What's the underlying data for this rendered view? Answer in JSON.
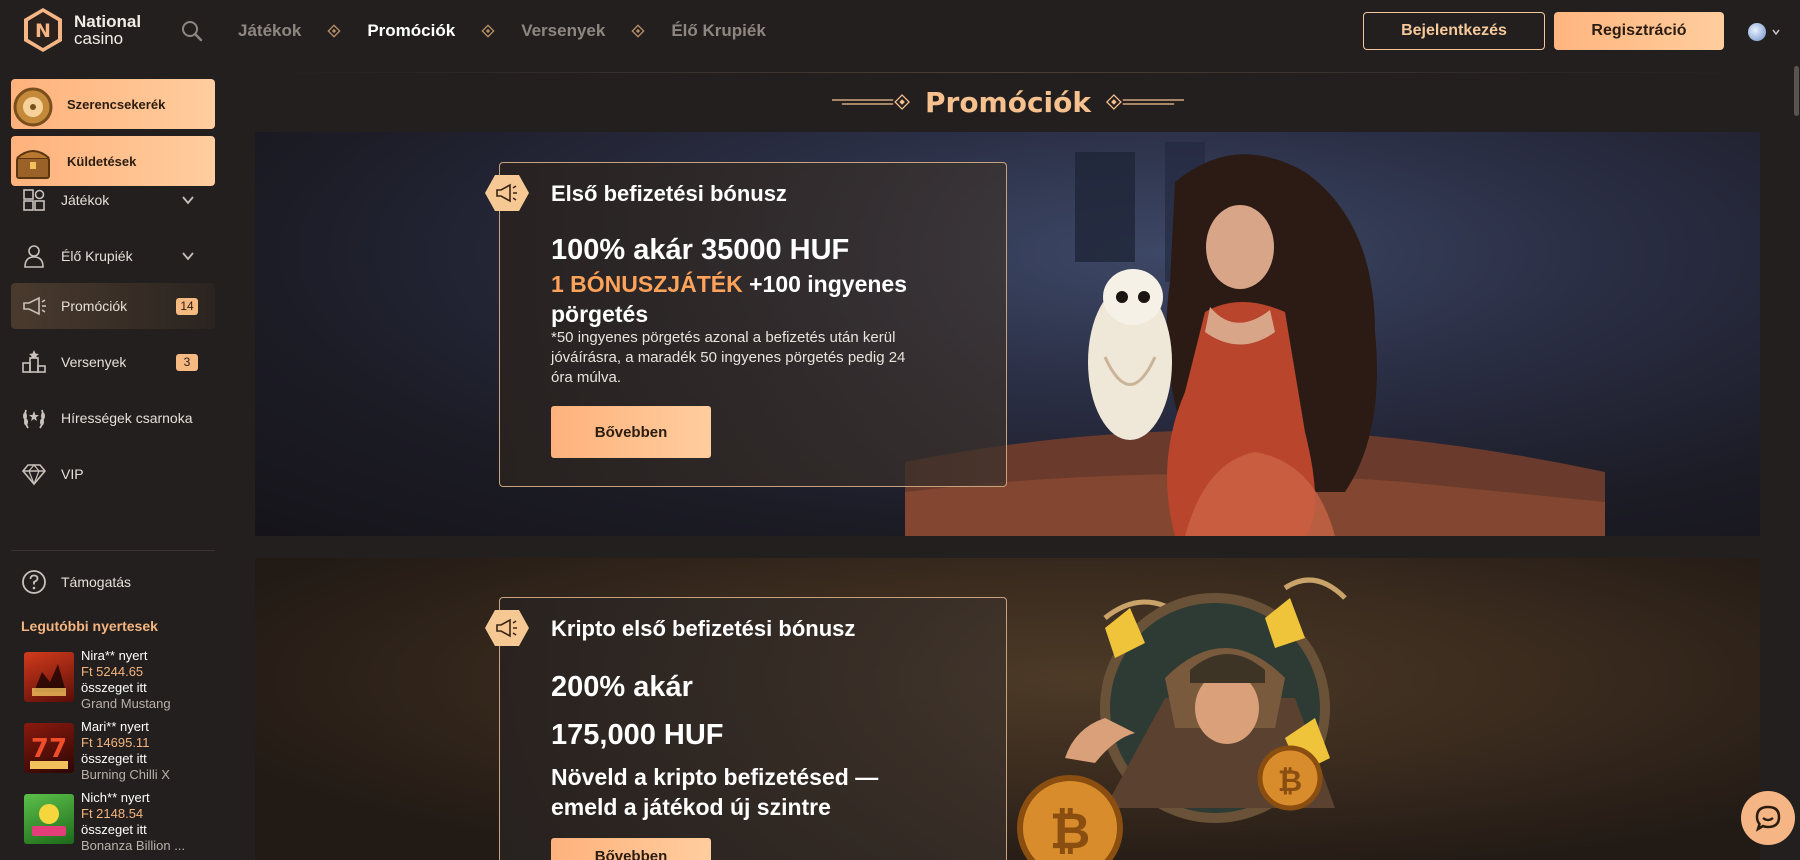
{
  "brand": {
    "line1": "National",
    "line2": "casino",
    "badge_letter": "N"
  },
  "nav": {
    "items": [
      "Játékok",
      "Promóciók",
      "Versenyek",
      "Élő Krupiék"
    ],
    "active": "Promóciók"
  },
  "header": {
    "login_label": "Bejelentkezés",
    "register_label": "Regisztráció"
  },
  "sidebar": {
    "promo_buttons": [
      "Szerencsekerék",
      "Küldetések"
    ],
    "items": [
      {
        "label": "Játékok",
        "icon": "puzzle-icon"
      },
      {
        "label": "Élő Krupiék",
        "icon": "dealer-icon"
      },
      {
        "label": "Promóciók",
        "icon": "megaphone-icon",
        "badge": "14"
      },
      {
        "label": "Versenyek",
        "icon": "tournament-icon",
        "badge": "3"
      },
      {
        "label": "Hírességek csarnoka",
        "icon": "laurel-icon"
      },
      {
        "label": "VIP",
        "icon": "diamond-icon"
      },
      {
        "label": "Támogatás",
        "icon": "help-icon"
      }
    ],
    "wins_title": "Legutóbbi nyertesek",
    "wins": [
      {
        "user": "Nira** nyert",
        "amount": "Ft 5244.65",
        "text": "összeget itt",
        "game": "Grand Mustang"
      },
      {
        "user": "Mari** nyert",
        "amount": "Ft 14695.11",
        "text": "összeget itt",
        "game": "Burning Chilli X"
      },
      {
        "user": "Nich** nyert",
        "amount": "Ft 2148.54",
        "text": "összeget itt",
        "game": "Bonanza Billion ..."
      }
    ]
  },
  "page": {
    "title": "Promóciók"
  },
  "promos": [
    {
      "title": "Első befizetési bónusz",
      "headline": "100% akár 35000 HUF",
      "sub_accent": "1 BÓNUSZJÁTÉK",
      "sub_rest": "+100 ingyenes pörgetés",
      "note": "*50 ingyenes pörgetés azonal a befizetés után kerül jóváírásra, a maradék 50 ingyenes pörgetés pedig 24 óra múlva.",
      "button": "Bővebben"
    },
    {
      "title": "Kripto első befizetési bónusz",
      "headline1": "200% akár",
      "headline2": "175,000 HUF",
      "sub": "Növeld a kripto befizetésed — emeld a játékod új szintre",
      "button": "Bővebben"
    }
  ],
  "colors": {
    "accent": "#f6b584",
    "background": "#231f1e",
    "gold": "#c8a27c"
  }
}
